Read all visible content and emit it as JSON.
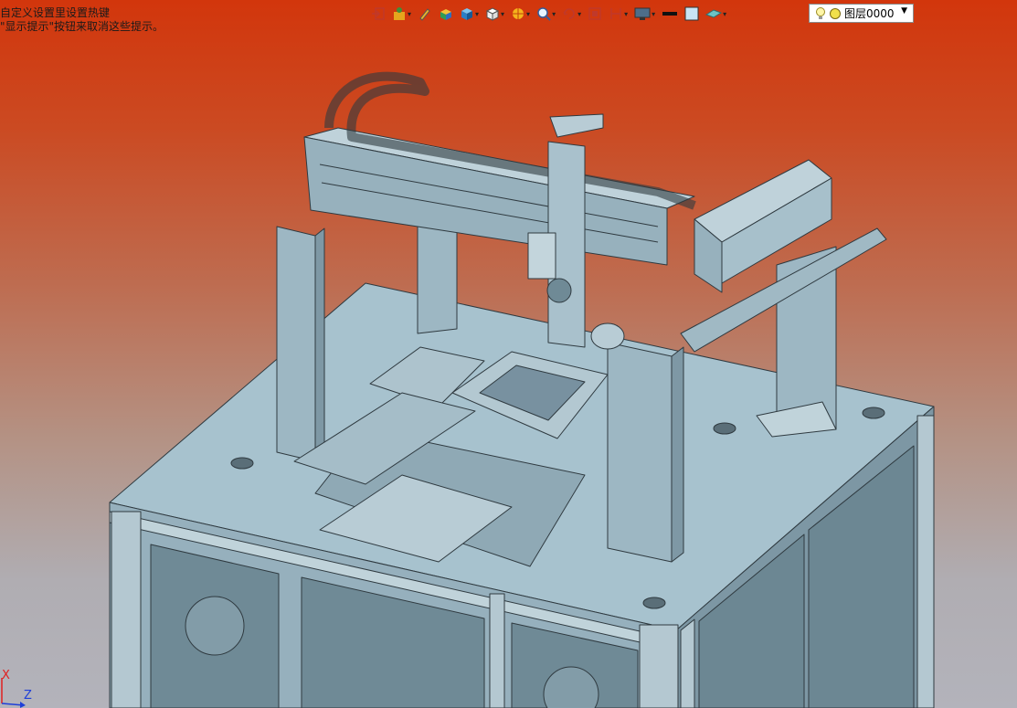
{
  "hint": {
    "line1": "自定义设置里设置热键",
    "line2": "\"显示提示\"按钮来取消这些提示。"
  },
  "toolbar": {
    "icons": [
      "exit-sketch-icon",
      "normal-view-icon",
      "sketch-pencil-icon",
      "shading-icon",
      "isometric-cube-icon",
      "wireframe-cube-icon",
      "render-sphere-icon",
      "zoom-icon",
      "rotate-icon",
      "fit-icon",
      "sectional-view-icon",
      "display-monitor-icon",
      "line-color-icon",
      "fill-color-icon",
      "material-icon",
      "light-icon"
    ],
    "layer_value": "图层0000",
    "colors": {
      "line": "#111111",
      "fill": "#c8e4f5"
    }
  },
  "axes": {
    "x_label": "X",
    "z_label": "Z"
  }
}
